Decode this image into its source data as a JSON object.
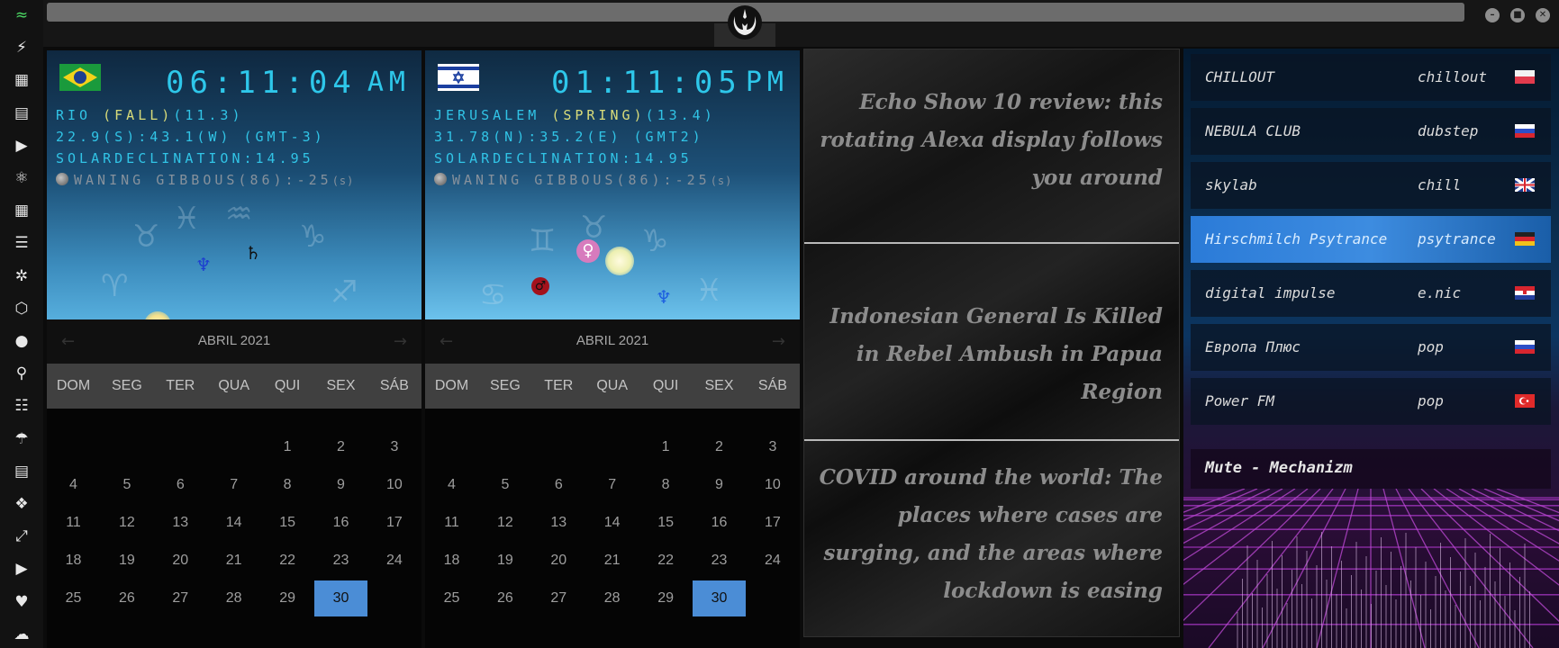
{
  "sidebar": {
    "icons": [
      "wifi-icon",
      "flash-icon",
      "windows-icon",
      "archive-icon",
      "play-icon",
      "translate-icon",
      "image-icon",
      "news-icon",
      "film-reel-icon",
      "hexagon-icon",
      "globe-icon",
      "search-icon",
      "map-icon",
      "umbrella-icon",
      "contacts-icon",
      "share-icon",
      "fullscreen-icon",
      "youtube-icon",
      "heart-icon",
      "cloud-icon"
    ]
  },
  "window_controls": [
    "minimize-icon",
    "maximize-icon",
    "close-icon"
  ],
  "clocks": [
    {
      "flag": "brazil",
      "time": "06:11:04",
      "ampm": "AM",
      "city": "RIO",
      "season": "(FALL)",
      "temp": "(11.3)",
      "coords": "22.9(S):43.1(W) (GMT-3)",
      "solar": "SOLARDECLINATION:14.95",
      "moon": "WANING GIBBOUS(86):-25",
      "moon_unit": "(s)"
    },
    {
      "flag": "israel",
      "time": "01:11:05",
      "ampm": "PM",
      "city": "JERUSALEM",
      "season": "(SPRING)",
      "temp": "(13.4)",
      "coords": "31.78(N):35.2(E) (GMT2)",
      "solar": "SOLARDECLINATION:14.95",
      "moon": "WANING GIBBOUS(86):-25",
      "moon_unit": "(s)"
    }
  ],
  "calendars": [
    {
      "month": "ABRIL 2021",
      "weekdays": [
        "DOM",
        "SEG",
        "TER",
        "QUA",
        "QUI",
        "SEX",
        "SÁB"
      ],
      "first_weekday": 4,
      "days": 30,
      "today": 30
    },
    {
      "month": "ABRIL 2021",
      "weekdays": [
        "DOM",
        "SEG",
        "TER",
        "QUA",
        "QUI",
        "SEX",
        "SÁB"
      ],
      "first_weekday": 4,
      "days": 30,
      "today": 30
    }
  ],
  "news": [
    "Echo Show 10 review: this rotating Alexa display follows you around",
    "Indonesian General Is Killed in Rebel Ambush in Papua Region",
    "COVID around the world: The places where cases are surging, and the areas where lockdown is easing"
  ],
  "radio": {
    "stations": [
      {
        "name": "CHILLOUT",
        "genre": "chillout",
        "flag": "poland",
        "active": false
      },
      {
        "name": "NEBULA CLUB",
        "genre": "dubstep",
        "flag": "russia",
        "active": false
      },
      {
        "name": "skylab",
        "genre": "chill",
        "flag": "uk",
        "active": false
      },
      {
        "name": "Hirschmilch Psytrance",
        "genre": "psytrance",
        "flag": "germany",
        "active": true
      },
      {
        "name": "digital impulse",
        "genre": "e.nic",
        "flag": "croatia",
        "active": false
      },
      {
        "name": "Европа Плюс",
        "genre": "pop",
        "flag": "russia",
        "active": false
      },
      {
        "name": "Power FM",
        "genre": "pop",
        "flag": "turkey",
        "active": false
      }
    ],
    "now_playing": "Mute - Mechanizm"
  }
}
